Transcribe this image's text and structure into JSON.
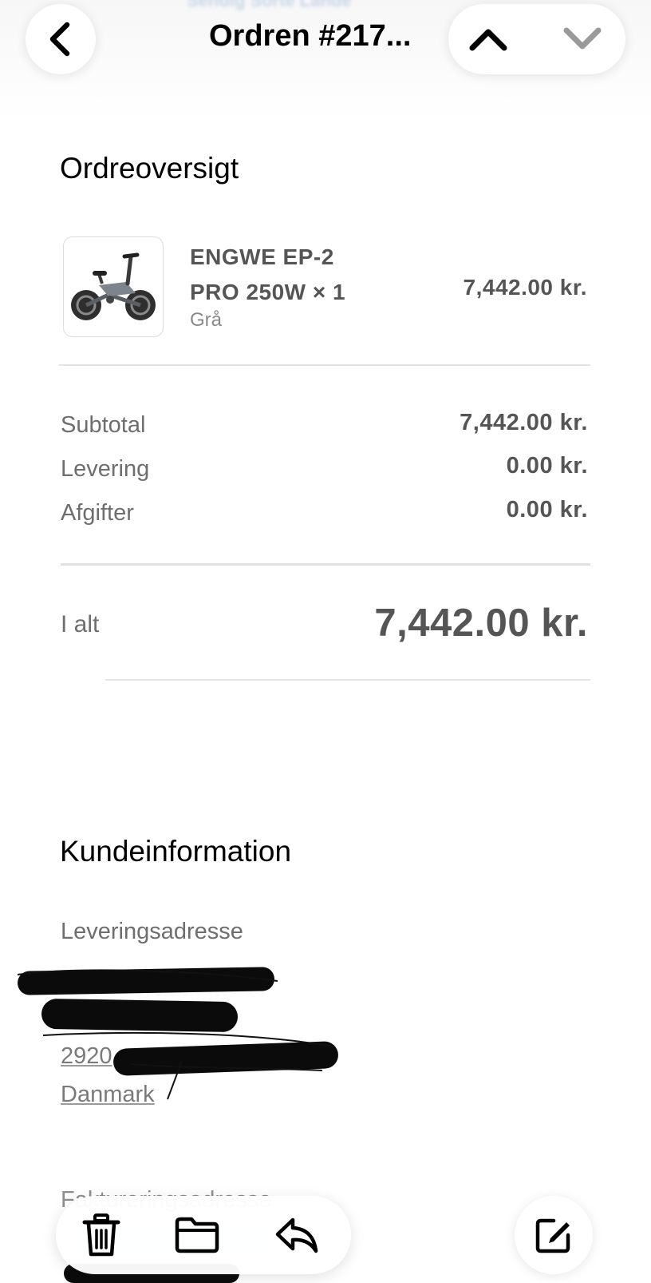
{
  "header": {
    "title": "Ordren #217...",
    "ghost_link_text": "Sendig Sorte Lande",
    "back_icon": "chevron-left-icon",
    "prev_icon": "chevron-up-icon",
    "next_icon": "chevron-down-icon"
  },
  "order_overview": {
    "heading": "Ordreoversigt",
    "item": {
      "image_icon": "electric-bike-image",
      "name_line1": "ENGWE EP-2",
      "name_line2": "PRO 250W × 1",
      "variant": "Grå",
      "price": "7,442.00 kr."
    },
    "summary": [
      {
        "label": "Subtotal",
        "value": "7,442.00 kr."
      },
      {
        "label": "Levering",
        "value": "0.00 kr."
      },
      {
        "label": "Afgifter",
        "value": "0.00 kr."
      }
    ],
    "total": {
      "label": "I alt",
      "value": "7,442.00 kr."
    }
  },
  "customer_info": {
    "heading": "Kundeinformation",
    "shipping_label": "Leveringsadresse",
    "postal_prefix": "2920",
    "country": "Danmark",
    "billing_label": "Faktureringsadresse"
  },
  "toolbar": {
    "trash_icon": "trash-icon",
    "folder_icon": "folder-icon",
    "reply_icon": "reply-icon",
    "compose_icon": "compose-icon"
  },
  "colors": {
    "primary_text": "#000000",
    "secondary_text": "#6e6e6e",
    "value_text": "#555555",
    "divider": "#e4e4e4"
  }
}
